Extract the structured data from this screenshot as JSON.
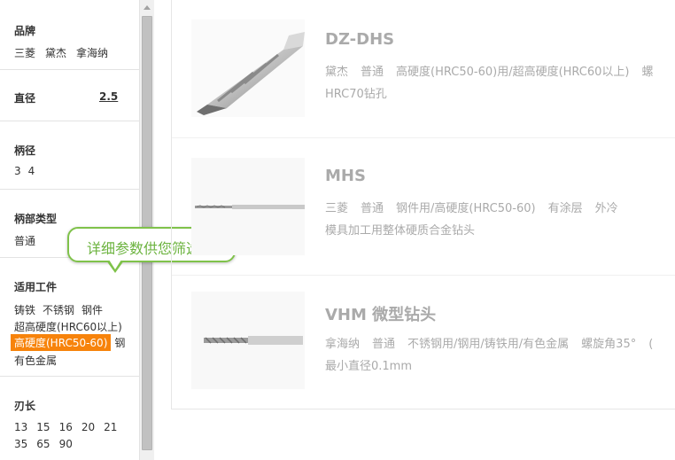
{
  "filters": {
    "brand": {
      "title": "品牌",
      "options": [
        "三菱",
        "黛杰",
        "拿海纳"
      ]
    },
    "diameter": {
      "title": "直径",
      "value": "2.5"
    },
    "shank_dia": {
      "title": "柄径",
      "options": [
        "3",
        "4"
      ]
    },
    "shank_type": {
      "title": "柄部类型",
      "options": [
        "普通"
      ]
    },
    "workpiece": {
      "title": "适用工件",
      "options_row1": [
        "铸铁",
        "不锈钢",
        "钢件"
      ],
      "options_row2": "超高硬度(HRC60以上)",
      "selected": "高硬度(HRC50-60)",
      "after_selected": "钢",
      "options_row4": "有色金属"
    },
    "blade_length": {
      "title": "刃长",
      "row1": [
        "13",
        "15",
        "16",
        "20",
        "21"
      ],
      "row2": [
        "35",
        "65",
        "90"
      ]
    }
  },
  "tooltip": {
    "text": "详细参数供您筛选"
  },
  "products": [
    {
      "name": "DZ-DHS",
      "tags": [
        "黛杰",
        "普通",
        "高硬度(HRC50-60)用/超高硬度(HRC60以上)",
        "螺"
      ],
      "desc": "HRC70钻孔"
    },
    {
      "name": "MHS",
      "tags": [
        "三菱",
        "普通",
        "钢件用/高硬度(HRC50-60)",
        "有涂层",
        "外冷"
      ],
      "desc": "模具加工用整体硬质合金钻头"
    },
    {
      "name": "VHM 微型钻头",
      "tags": [
        "拿海纳",
        "普通",
        "不锈钢用/钢用/铸铁用/有色金属",
        "螺旋角35°",
        "("
      ],
      "desc": "最小直径0.1mm"
    }
  ],
  "colors": {
    "accent": "#f7830b",
    "tooltip_border": "#7fc24a",
    "muted_text": "#aaaaaa"
  }
}
